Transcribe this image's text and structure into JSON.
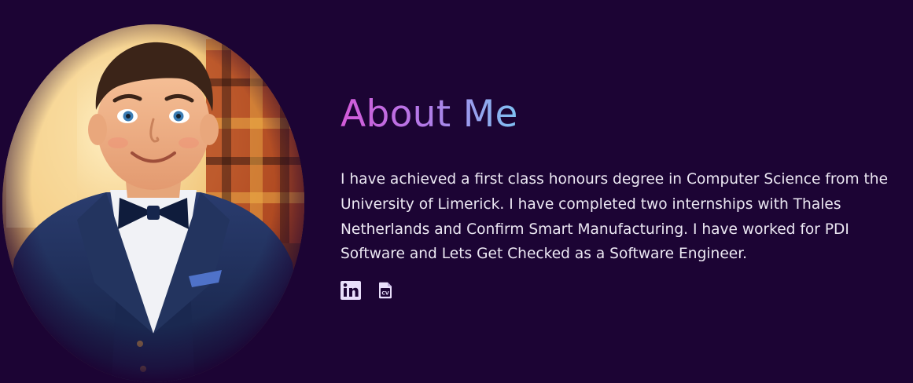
{
  "about": {
    "title": "About Me",
    "bio": "I have achieved a first class honours degree in Computer Science from the University of Limerick. I have completed two internships with Thales Netherlands and Confirm Smart Manufacturing. I have worked for PDI Software and Lets Get Checked as a Software Engineer.",
    "portrait_icon": "portrait-illustration",
    "title_gradient": [
      "#d35ad8",
      "#b27ae8",
      "#7fc2f2"
    ]
  },
  "socials": [
    {
      "icon": "linkedin-icon",
      "color": "#e8defa"
    },
    {
      "icon": "cv-document-icon",
      "color": "#e8defa"
    }
  ],
  "colors": {
    "background": "#1c0434",
    "text": "#ece8f3",
    "suit": "#1d2c55",
    "tie": "#0f1c3c"
  }
}
